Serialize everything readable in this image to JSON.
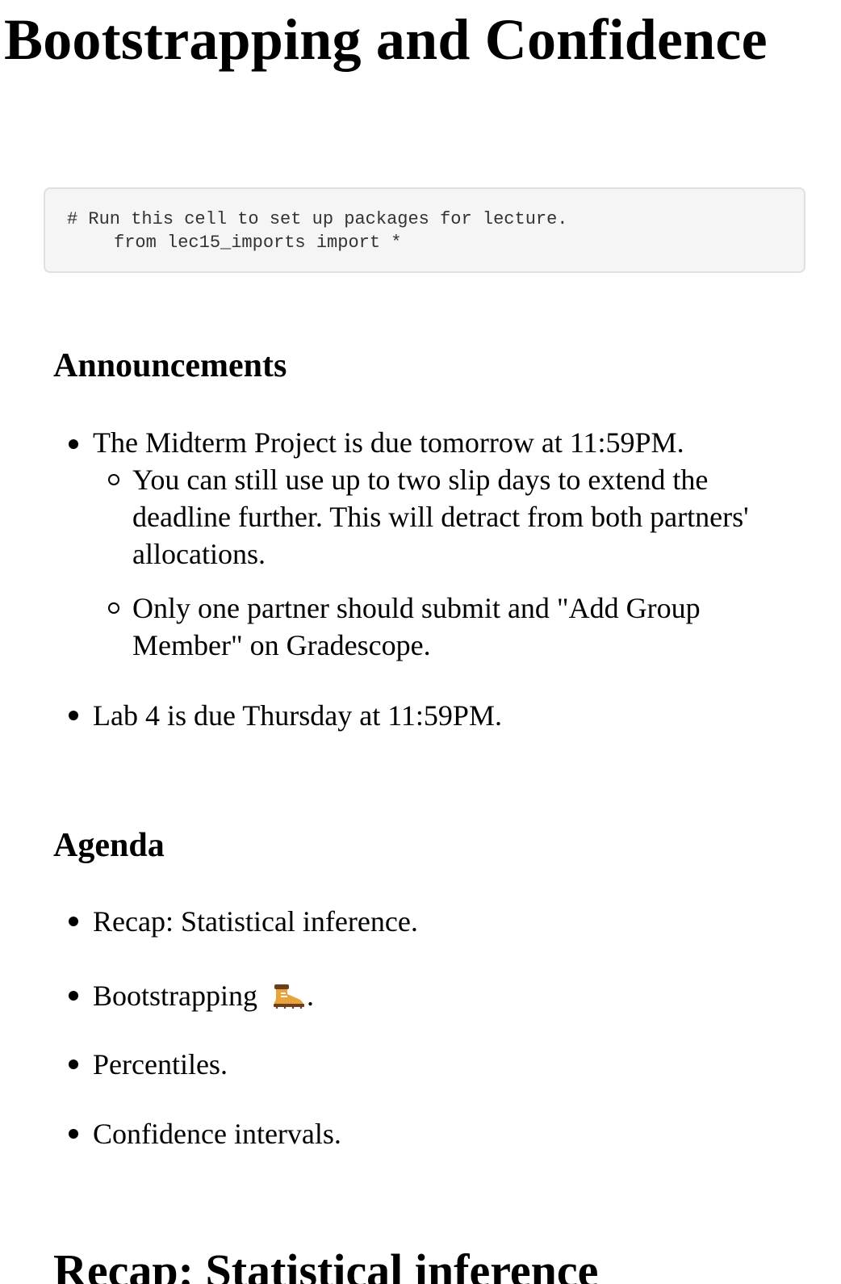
{
  "title": "Bootstrapping and Confidence",
  "code_cell": {
    "line1": "# Run this cell to set up packages for lecture.",
    "line2": "from lec15_imports import *"
  },
  "announcements": {
    "heading": "Announcements",
    "item1": "The Midterm Project is due tomorrow at 11:59PM.",
    "item1_sub1": "You can still use up to two slip days to extend the deadline further. This will detract from both partners' allocations.",
    "item1_sub2": "Only one partner should submit and \"Add Group Member\" on Gradescope.",
    "item2": "Lab 4 is due Thursday at 11:59PM."
  },
  "agenda": {
    "heading": "Agenda",
    "item1": "Recap: Statistical inference.",
    "item2": "Bootstrapping",
    "item2_suffix": ".",
    "item2_icon": "hiking-boot-icon",
    "item3": "Percentiles.",
    "item4": "Confidence intervals."
  },
  "recap": {
    "heading": "Recap: Statistical inference"
  },
  "colors": {
    "code_background": "#f5f5f5",
    "code_border": "#e0e0e0",
    "boot_body": "#e8a33d",
    "boot_dark": "#6b3f1c"
  }
}
